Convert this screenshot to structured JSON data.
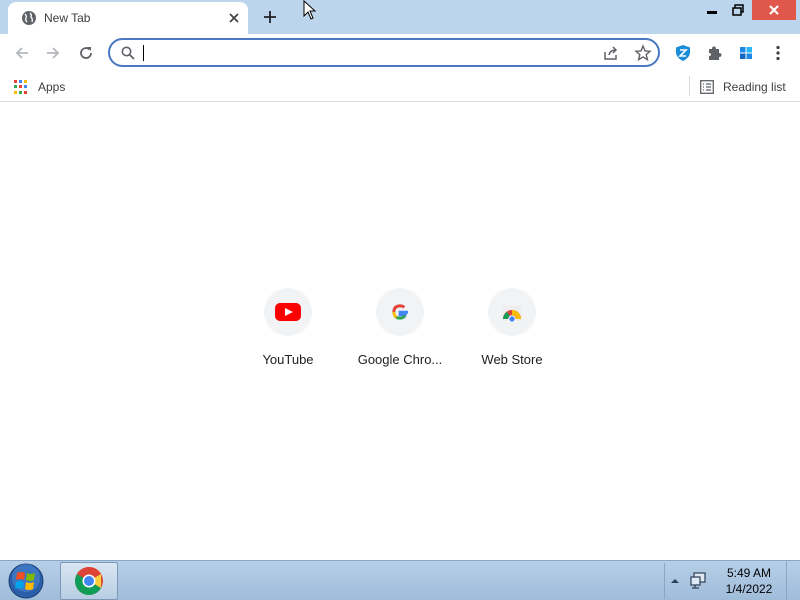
{
  "tab": {
    "title": "New Tab",
    "favicon": "globe-icon",
    "close_icon": "close-icon"
  },
  "window_controls": {
    "minimize": "minimize-icon",
    "maximize": "restore-icon",
    "close": "close-icon"
  },
  "omnibox": {
    "value": "",
    "placeholder": ""
  },
  "bookmarks": {
    "apps_label": "Apps",
    "reading_list_label": "Reading list"
  },
  "shortcuts": [
    {
      "label": "YouTube",
      "icon": "youtube-icon"
    },
    {
      "label": "Google Chro...",
      "icon": "google-g-icon"
    },
    {
      "label": "Web Store",
      "icon": "chrome-web-store-icon"
    }
  ],
  "taskbar": {
    "time": "5:49 AM",
    "date": "1/4/2022"
  },
  "colors": {
    "titlebar": "#bcd4ec",
    "omnibox_border": "#4a78c2",
    "youtube_red": "#ff0000",
    "close_red": "#e0584c"
  }
}
